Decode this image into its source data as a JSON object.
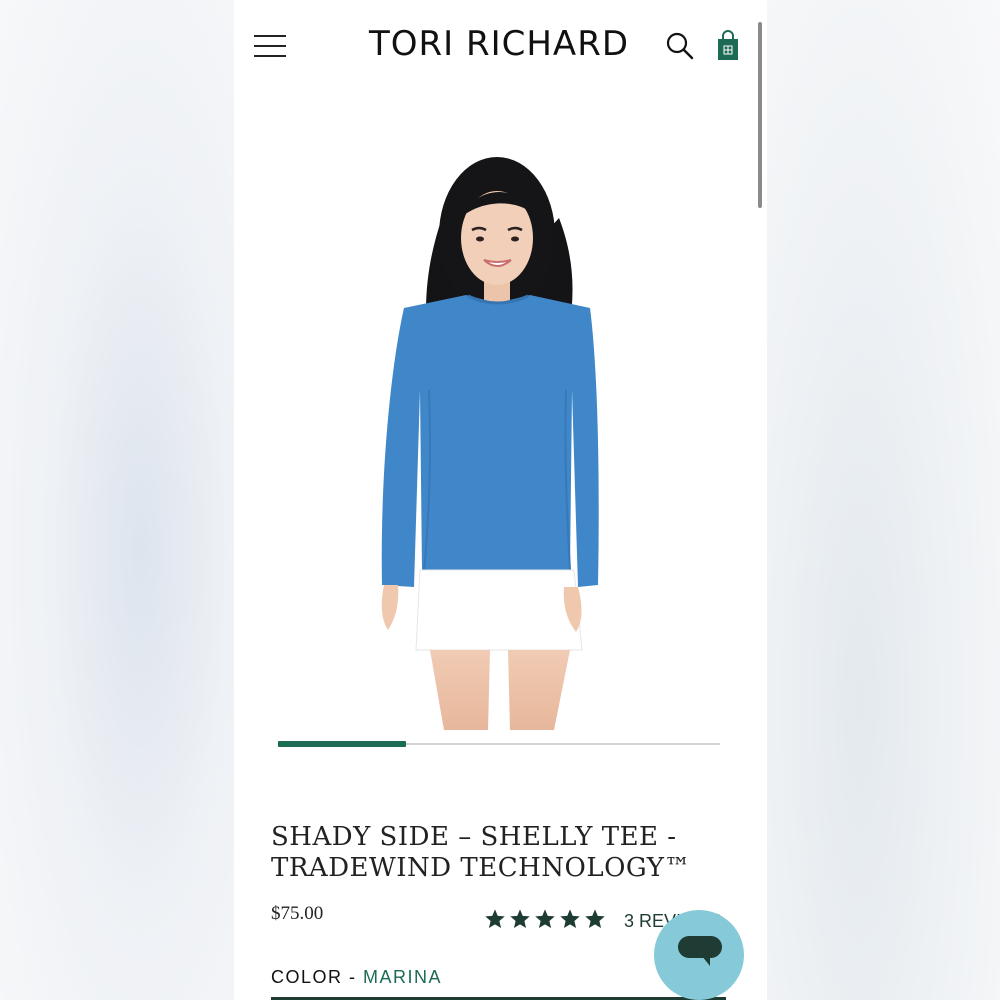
{
  "header": {
    "logo": "TORI RICHARD",
    "menu_icon": "hamburger-menu-icon",
    "search_icon": "search-icon",
    "bag_icon": "shopping-bag-icon"
  },
  "carousel": {
    "progress": 0.29
  },
  "product": {
    "title_line1": "SHADY SIDE – SHELLY TEE -",
    "title_line2": "TRADEWIND TECHNOLOGY™",
    "price": "$75.00",
    "rating": 5,
    "reviews_label": "3 REVIEWS",
    "color_label": "COLOR - ",
    "color_value": "MARINA"
  },
  "chat": {
    "icon": "chat-bubble-icon"
  },
  "colors": {
    "brand_green": "#1e6b55",
    "dark_green": "#1e3b34",
    "shirt_blue": "#3f87c9",
    "chat_bg": "#86c9d8"
  }
}
